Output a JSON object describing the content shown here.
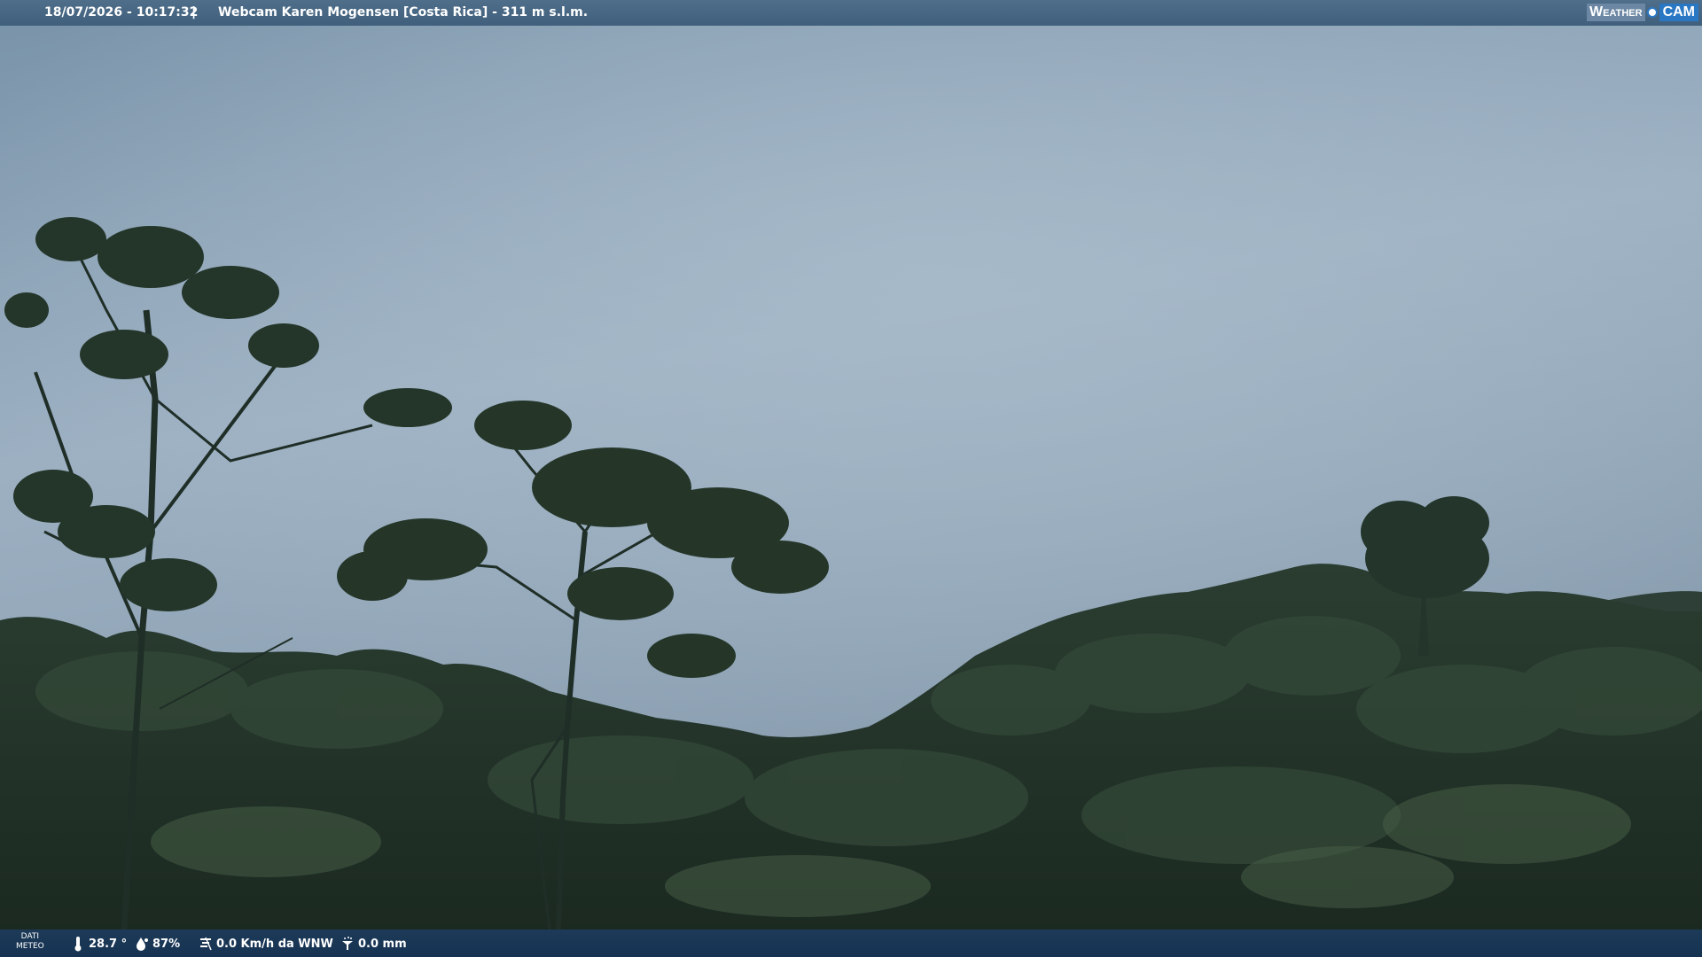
{
  "overlay_top": {
    "datetime": "18/07/2026 - 10:17:32",
    "separator": "|",
    "title": "Webcam Karen Mogensen [Costa Rica] - 311 m s.l.m.",
    "logo_left": "Weather",
    "logo_right": "CAM"
  },
  "overlay_bottom": {
    "dati_line1": "DATI",
    "dati_line2": "METEO",
    "temperature": "28.7 °",
    "humidity": "87%",
    "wind": "0.0 Km/h da WNW",
    "rain": "0.0 mm",
    "icons": [
      "thermometer-icon",
      "humidity-icon",
      "wind-icon",
      "rain-gauge-icon"
    ]
  },
  "colors": {
    "sky_top": "#7f98ad",
    "sky_mid": "#9fb3c4",
    "sky_low": "#889eb0",
    "forest_dark": "#1c2a22",
    "forest_mid": "#2c3e30",
    "bar_top": "#4a6a86",
    "bar_bottom": "#173353",
    "logo_blue": "#2a77c4"
  }
}
